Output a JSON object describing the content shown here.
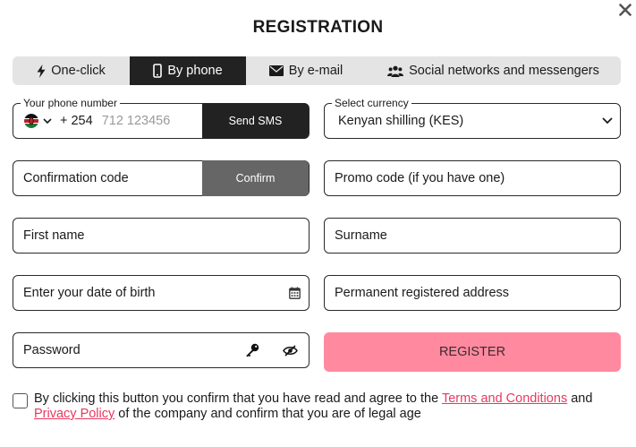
{
  "title": "REGISTRATION",
  "tabs": [
    {
      "label": "One-click",
      "icon": "lightning-icon"
    },
    {
      "label": "By phone",
      "icon": "phone-icon",
      "active": true
    },
    {
      "label": "By e-mail",
      "icon": "envelope-icon"
    },
    {
      "label": "Social networks and messengers",
      "icon": "users-icon"
    }
  ],
  "phone": {
    "legend": "Your phone number",
    "country_code": "+ 254",
    "placeholder": "712 123456",
    "send_sms": "Send SMS"
  },
  "currency": {
    "legend": "Select currency",
    "value": "Kenyan shilling (KES)"
  },
  "confirmation": {
    "placeholder": "Confirmation code",
    "confirm": "Confirm"
  },
  "promo": {
    "placeholder": "Promo code (if you have one)"
  },
  "first_name": {
    "placeholder": "First name"
  },
  "surname": {
    "placeholder": "Surname"
  },
  "dob": {
    "placeholder": "Enter your date of birth"
  },
  "address": {
    "placeholder": "Permanent registered address"
  },
  "password": {
    "placeholder": "Password"
  },
  "register": "REGISTER",
  "agreement": {
    "text_before": "By clicking this button you confirm that you have read and agree to the ",
    "terms": "Terms and Conditions",
    "text_and": " and ",
    "privacy": "Privacy Policy",
    "text_after": " of the company and confirm that you are of legal age"
  },
  "colors": {
    "primary_dark": "#222222",
    "confirm_gray": "#666666",
    "register_pink": "#ff8aa0",
    "link_red": "#e8385e"
  }
}
